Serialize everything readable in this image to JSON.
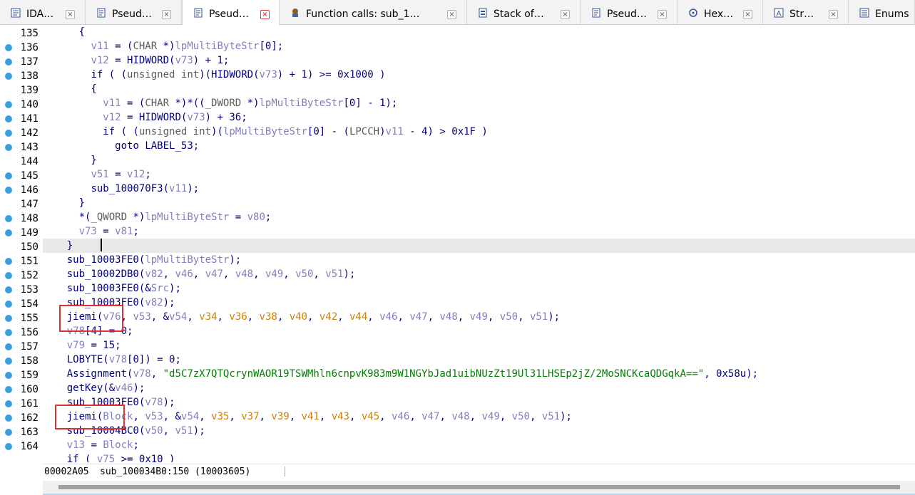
{
  "tabs": [
    {
      "label": "IDA…",
      "icon": "ida-view-icon",
      "active": false
    },
    {
      "label": "Pseud…",
      "icon": "pseudocode-icon",
      "active": false
    },
    {
      "label": "Pseud…",
      "icon": "pseudocode-icon",
      "active": true
    },
    {
      "label": "Function calls: sub_1…",
      "icon": "function-calls-icon",
      "active": false
    },
    {
      "label": "Stack of…",
      "icon": "stack-icon",
      "active": false
    },
    {
      "label": "Pseud…",
      "icon": "pseudocode-icon",
      "active": false
    },
    {
      "label": "Hex…",
      "icon": "hex-view-icon",
      "active": false
    },
    {
      "label": "Str…",
      "icon": "strings-icon",
      "active": false
    },
    {
      "label": "Enums",
      "icon": "enums-icon",
      "active": false
    }
  ],
  "code_lines": [
    {
      "num": "135",
      "text": "      {"
    },
    {
      "num": "136",
      "text": "        v11 = (CHAR *)lpMultiByteStr[0];"
    },
    {
      "num": "137",
      "text": "        v12 = HIDWORD(v73) + 1;"
    },
    {
      "num": "138",
      "text": "        if ( (unsigned int)(HIDWORD(v73) + 1) >= 0x1000 )"
    },
    {
      "num": "139",
      "text": "        {"
    },
    {
      "num": "140",
      "text": "          v11 = (CHAR *)*((_DWORD *)lpMultiByteStr[0] - 1);"
    },
    {
      "num": "141",
      "text": "          v12 = HIDWORD(v73) + 36;"
    },
    {
      "num": "142",
      "text": "          if ( (unsigned int)(lpMultiByteStr[0] - (LPCCH)v11 - 4) > 0x1F )"
    },
    {
      "num": "143",
      "text": "            goto LABEL_53;"
    },
    {
      "num": "144",
      "text": "        }"
    },
    {
      "num": "145",
      "text": "        v51 = v12;"
    },
    {
      "num": "146",
      "text": "        sub_100070F3(v11);"
    },
    {
      "num": "147",
      "text": "      }"
    },
    {
      "num": "148",
      "text": "      *(_QWORD *)lpMultiByteStr = v80;"
    },
    {
      "num": "149",
      "text": "      v73 = v81;"
    },
    {
      "num": "150",
      "text": "    }"
    },
    {
      "num": "151",
      "text": "    sub_10003FE0(lpMultiByteStr);"
    },
    {
      "num": "152",
      "text": "    sub_10002DB0(v82, v46, v47, v48, v49, v50, v51);"
    },
    {
      "num": "153",
      "text": "    sub_10003FE0(&Src);"
    },
    {
      "num": "154",
      "text": "    sub_10003FE0(v82);"
    },
    {
      "num": "155",
      "text": "    jiemi(v76, v53, &v54, v34, v36, v38, v40, v42, v44, v46, v47, v48, v49, v50, v51);"
    },
    {
      "num": "156",
      "text": "    v78[4] = 0;"
    },
    {
      "num": "157",
      "text": "    v79 = 15;"
    },
    {
      "num": "158",
      "text": "    LOBYTE(v78[0]) = 0;"
    },
    {
      "num": "159",
      "text": "    Assignment(v78, \"d5C7zX7QTQcrynWAOR19TSWMhln6cnpvK983m9W1NGYbJad1uibNUzZt19Ul31LHSEp2jZ/2MoSNCKcaQDGqkA==\", 0x58u);"
    },
    {
      "num": "160",
      "text": "    getKey(&v46);"
    },
    {
      "num": "161",
      "text": "    sub_10003FE0(v78);"
    },
    {
      "num": "162",
      "text": "    jiemi(Block, v53, &v54, v35, v37, v39, v41, v43, v45, v46, v47, v48, v49, v50, v51);"
    },
    {
      "num": "163",
      "text": "    sub_10004BC0(v50, v51);"
    },
    {
      "num": "164",
      "text": "    v13 = Block;"
    },
    {
      "num": "",
      "text": "    if ( v75 >= 0x10 )"
    }
  ],
  "status": {
    "address": "00002A05",
    "location": "sub_100034B0:150 (10003605)"
  },
  "colors": {
    "plain": "#000080",
    "variable": "#8080c0",
    "keyword": "#5c5c5c",
    "stackvar": "#d08000",
    "string": "#008000",
    "highlight": "#e8e8e8",
    "breakpoint": "#3aa0dc",
    "annotation": "#e03030"
  }
}
